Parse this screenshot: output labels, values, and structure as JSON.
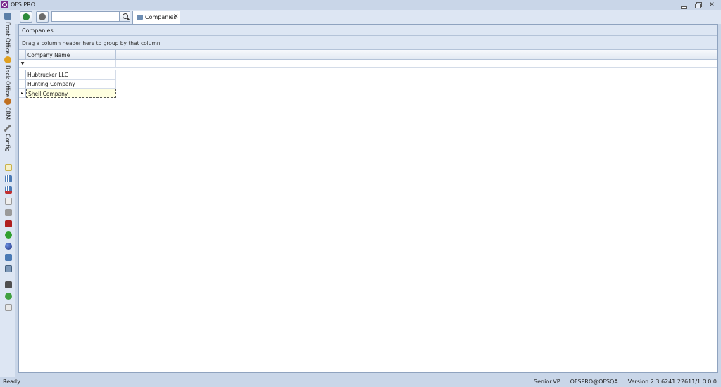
{
  "window": {
    "title": "OFS PRO",
    "buttons": [
      "minimize",
      "restore",
      "close"
    ],
    "close_glyph": "✕"
  },
  "rail": {
    "tabs": [
      {
        "label": "Front Office",
        "icon": "front-office-icon",
        "color": "#5b7fa8"
      },
      {
        "label": "Back Office",
        "icon": "back-office-icon",
        "color": "#e0a020"
      },
      {
        "label": "CRM",
        "icon": "crm-icon",
        "color": "#c07020"
      },
      {
        "label": "Config",
        "icon": "wrench-icon",
        "color": "#777777"
      }
    ],
    "tools": [
      {
        "icon": "new-document-icon",
        "color": "#f0d060"
      },
      {
        "icon": "grid-view-icon",
        "color": "#4a7ab5"
      },
      {
        "icon": "grid-delete-icon",
        "color": "#c03030"
      },
      {
        "icon": "copy-icon",
        "color": "#b0b0b0"
      },
      {
        "icon": "tools-icon",
        "color": "#808080"
      },
      {
        "icon": "chart-icon",
        "color": "#b02020"
      },
      {
        "icon": "refresh-icon",
        "color": "#30a030"
      },
      {
        "icon": "globe-icon",
        "color": "#3050b0"
      },
      {
        "icon": "windows-icon",
        "color": "#4a7ab5"
      },
      {
        "icon": "calculator-icon",
        "color": "#5a7a9a"
      },
      {
        "icon": "user-icon",
        "color": "#505050"
      },
      {
        "icon": "help-icon",
        "color": "#40a040"
      },
      {
        "icon": "mail-icon",
        "color": "#a0a0a0"
      }
    ]
  },
  "toolbar": {
    "refresh_icon": "refresh-icon",
    "tools_icon": "tools-icon",
    "search_value": "",
    "search_placeholder": ""
  },
  "tabs": [
    {
      "label": "Companies",
      "close": "✕"
    }
  ],
  "panel": {
    "caption": "Companies",
    "group_hint": "Drag a column header here to group by that column"
  },
  "grid": {
    "columns": [
      "Company Name"
    ],
    "filter_glyph": "▼",
    "row_indicator_glyph": "▸",
    "rows": [
      {
        "company_name": "Hubtrucker LLC",
        "selected": false
      },
      {
        "company_name": "Hunting Company",
        "selected": false
      },
      {
        "company_name": "Shell Company",
        "selected": true
      }
    ]
  },
  "status": {
    "left": "Ready",
    "user": "Senior.VP",
    "connection": "OFSPRO@OFSQA",
    "version": "Version 2.3.6241.22611/1.0.0.0"
  },
  "colors": {
    "accent": "#7a2a8f",
    "chrome": "#c9d6e8",
    "panel_header": "#dde6f3",
    "selection": "#ffffe0"
  }
}
